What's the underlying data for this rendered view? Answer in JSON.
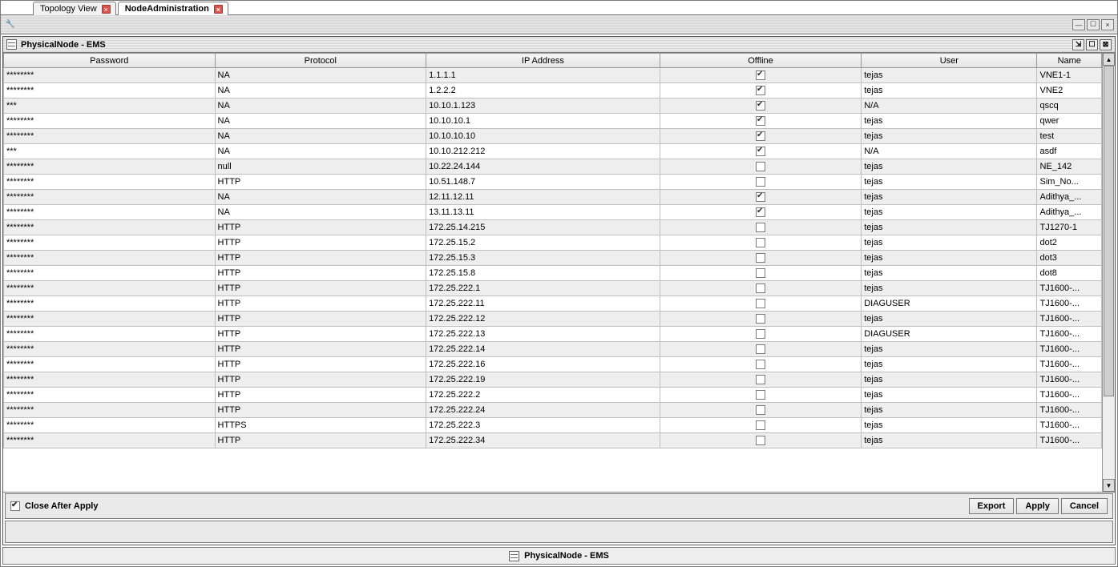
{
  "tabs": [
    {
      "label": "Topology View",
      "active": false
    },
    {
      "label": "NodeAdministration",
      "active": true
    }
  ],
  "window": {
    "title": "PhysicalNode - EMS"
  },
  "columns": {
    "password": "Password",
    "protocol": "Protocol",
    "ip": "IP Address",
    "offline": "Offline",
    "user": "User",
    "name": "Name"
  },
  "rows": [
    {
      "pw": "********",
      "proto": "NA",
      "ip": "1.1.1.1",
      "off": true,
      "user": "tejas",
      "name": "VNE1-1"
    },
    {
      "pw": "********",
      "proto": "NA",
      "ip": "1.2.2.2",
      "off": true,
      "user": "tejas",
      "name": "VNE2"
    },
    {
      "pw": "***",
      "proto": "NA",
      "ip": "10.10.1.123",
      "off": true,
      "user": "N/A",
      "name": "qscq"
    },
    {
      "pw": "********",
      "proto": "NA",
      "ip": "10.10.10.1",
      "off": true,
      "user": "tejas",
      "name": "qwer"
    },
    {
      "pw": "********",
      "proto": "NA",
      "ip": "10.10.10.10",
      "off": true,
      "user": "tejas",
      "name": "test"
    },
    {
      "pw": "***",
      "proto": "NA",
      "ip": "10.10.212.212",
      "off": true,
      "user": "N/A",
      "name": "asdf"
    },
    {
      "pw": "********",
      "proto": "null",
      "ip": "10.22.24.144",
      "off": false,
      "user": "tejas",
      "name": "NE_142"
    },
    {
      "pw": "********",
      "proto": "HTTP",
      "ip": "10.51.148.7",
      "off": false,
      "user": "tejas",
      "name": "Sim_No..."
    },
    {
      "pw": "********",
      "proto": "NA",
      "ip": "12.11.12.11",
      "off": true,
      "user": "tejas",
      "name": "Adithya_..."
    },
    {
      "pw": "********",
      "proto": "NA",
      "ip": "13.11.13.11",
      "off": true,
      "user": "tejas",
      "name": "Adithya_..."
    },
    {
      "pw": "********",
      "proto": "HTTP",
      "ip": "172.25.14.215",
      "off": false,
      "user": "tejas",
      "name": "TJ1270-1"
    },
    {
      "pw": "********",
      "proto": "HTTP",
      "ip": "172.25.15.2",
      "off": false,
      "user": "tejas",
      "name": "dot2"
    },
    {
      "pw": "********",
      "proto": "HTTP",
      "ip": "172.25.15.3",
      "off": false,
      "user": "tejas",
      "name": "dot3"
    },
    {
      "pw": "********",
      "proto": "HTTP",
      "ip": "172.25.15.8",
      "off": false,
      "user": "tejas",
      "name": "dot8"
    },
    {
      "pw": "********",
      "proto": "HTTP",
      "ip": "172.25.222.1",
      "off": false,
      "user": "tejas",
      "name": "TJ1600-..."
    },
    {
      "pw": "********",
      "proto": "HTTP",
      "ip": "172.25.222.11",
      "off": false,
      "user": "DIAGUSER",
      "name": "TJ1600-..."
    },
    {
      "pw": "********",
      "proto": "HTTP",
      "ip": "172.25.222.12",
      "off": false,
      "user": "tejas",
      "name": "TJ1600-..."
    },
    {
      "pw": "********",
      "proto": "HTTP",
      "ip": "172.25.222.13",
      "off": false,
      "user": "DIAGUSER",
      "name": "TJ1600-..."
    },
    {
      "pw": "********",
      "proto": "HTTP",
      "ip": "172.25.222.14",
      "off": false,
      "user": "tejas",
      "name": "TJ1600-..."
    },
    {
      "pw": "********",
      "proto": "HTTP",
      "ip": "172.25.222.16",
      "off": false,
      "user": "tejas",
      "name": "TJ1600-..."
    },
    {
      "pw": "********",
      "proto": "HTTP",
      "ip": "172.25.222.19",
      "off": false,
      "user": "tejas",
      "name": "TJ1600-..."
    },
    {
      "pw": "********",
      "proto": "HTTP",
      "ip": "172.25.222.2",
      "off": false,
      "user": "tejas",
      "name": "TJ1600-..."
    },
    {
      "pw": "********",
      "proto": "HTTP",
      "ip": "172.25.222.24",
      "off": false,
      "user": "tejas",
      "name": "TJ1600-..."
    },
    {
      "pw": "********",
      "proto": "HTTPS",
      "ip": "172.25.222.3",
      "off": false,
      "user": "tejas",
      "name": "TJ1600-..."
    },
    {
      "pw": "********",
      "proto": "HTTP",
      "ip": "172.25.222.34",
      "off": false,
      "user": "tejas",
      "name": "TJ1600-..."
    }
  ],
  "footer": {
    "close_after_apply": "Close After Apply",
    "close_after_apply_checked": true,
    "export": "Export",
    "apply": "Apply",
    "cancel": "Cancel"
  },
  "status": {
    "label": "PhysicalNode - EMS"
  }
}
